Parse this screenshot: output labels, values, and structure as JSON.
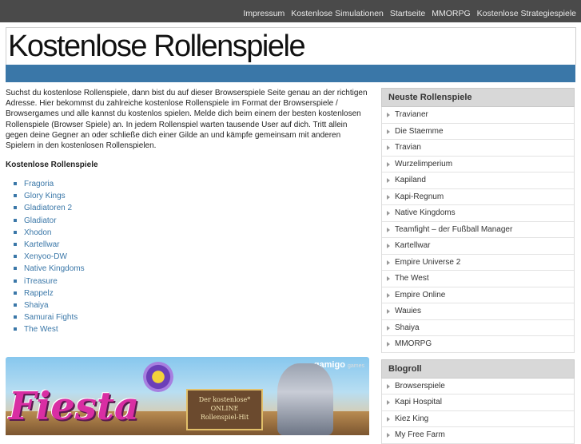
{
  "topnav": [
    "Impressum",
    "Kostenlose Simulationen",
    "Startseite",
    "MMORPG",
    "Kostenlose Strategiespiele"
  ],
  "page_title": "Kostenlose Rollenspiele",
  "intro": "Suchst du kostenlose Rollenspiele, dann bist du auf dieser Browserspiele Seite genau an der richtigen Adresse. Hier bekommst du zahlreiche kostenlose Rollenspiele im Format der Browserspiele / Browsergames und alle kannst du kostenlos spielen. Melde dich beim einem der besten kostenlosen Rollenspiele (Browser Spiele) an. In jedem Rollenspiel warten tausende User auf dich. Tritt allein gegen deine Gegner an oder schließe dich einer Gilde an und kämpfe gemeinsam mit anderen Spielern in den kostenlosen Rollenspielen.",
  "list_heading": "Kostenlose Rollenspiele",
  "games": [
    "Fragoria",
    "Glory Kings",
    "Gladiatoren 2",
    "Gladiator",
    "Xhodon",
    "Kartellwar",
    "Xenyoo-DW",
    "Native Kingdoms",
    "iTreasure",
    "Rappelz",
    "Shaiya",
    "Samurai Fights",
    "The West"
  ],
  "banner": {
    "brand": "gamigo",
    "brand_sub": "games",
    "logo": "Fiesta",
    "tag_lines": [
      "Der kostenlose*",
      "ONLINE",
      "Rollenspiel-Hit"
    ]
  },
  "sidebar": {
    "newest_title": "Neuste Rollenspiele",
    "newest": [
      "Travianer",
      "Die Staemme",
      "Travian",
      "Wurzelimperium",
      "Kapiland",
      "Kapi-Regnum",
      "Native Kingdoms",
      "Teamfight – der Fußball Manager",
      "Kartellwar",
      "Empire Universe 2",
      "The West",
      "Empire Online",
      "Wauies",
      "Shaiya",
      "MMORPG"
    ],
    "blogroll_title": "Blogroll",
    "blogroll": [
      "Browserspiele",
      "Kapi Hospital",
      "Kiez King",
      "My Free Farm"
    ]
  },
  "colors": {
    "topbar": "#4a4a4a",
    "accent": "#3a77a8",
    "widget_header": "#d8d8d8"
  }
}
